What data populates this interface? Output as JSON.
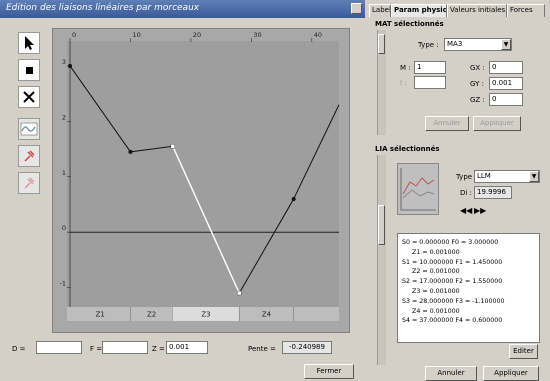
{
  "left_window": {
    "title": "Edition des liaisons linéaires par morceaux",
    "footer": {
      "d_label": "D =",
      "d_value": "",
      "f_label": "F =",
      "f_value": "",
      "z_label": "Z =",
      "z_value": "0.001",
      "pente_label": "Pente =",
      "pente_value": "-0.240989",
      "close_label": "Fermer"
    }
  },
  "tools": [
    "select-arrow",
    "square",
    "cross",
    "wave",
    "pin",
    "pin-alt"
  ],
  "chart_data": {
    "type": "line",
    "x_ticks": [
      "0",
      "10",
      "20",
      "30",
      "40"
    ],
    "x_tick_values": [
      0,
      10,
      20,
      30,
      40
    ],
    "y_ticks": [
      "3",
      "2",
      "1",
      "0",
      "-1"
    ],
    "y_tick_values": [
      3,
      2,
      1,
      0,
      -1
    ],
    "xlim": [
      -0.5,
      44.5
    ],
    "ylim": [
      -1.35,
      3.45
    ],
    "points": [
      {
        "x": 0,
        "y": 3.0,
        "marker": "dark"
      },
      {
        "x": 10,
        "y": 1.45,
        "marker": "dark"
      },
      {
        "x": 17,
        "y": 1.55,
        "marker": "light"
      },
      {
        "x": 28,
        "y": -1.1,
        "marker": "light"
      },
      {
        "x": 37,
        "y": 0.6,
        "marker": "dark"
      },
      {
        "x": 44.5,
        "y": 2.3,
        "marker": "none"
      }
    ],
    "highlight_segment": [
      2,
      3
    ],
    "baseline_y": 0,
    "zones": [
      {
        "label": "Z1",
        "from": 0,
        "to": 10
      },
      {
        "label": "Z2",
        "from": 10,
        "to": 17
      },
      {
        "label": "Z3",
        "from": 17,
        "to": 28
      },
      {
        "label": "Z4",
        "from": 28,
        "to": 37
      }
    ],
    "active_zone": 2,
    "colors": {
      "plot_bg": "#9e9e9e",
      "line": "#111111",
      "highlight": "#ffffff",
      "axis_band": "#bdbdbd",
      "active_zone": "#dcdcdc"
    }
  },
  "right_window": {
    "tabs": [
      "Labels",
      "Param physiques",
      "Valeurs initiales",
      "Forces"
    ],
    "active_tab": 1,
    "mat_section": {
      "title": "MAT sélectionnés",
      "type_label": "Type :",
      "type_value": "MA3",
      "m_label": "M :",
      "m_value": "1",
      "i_label": "I :",
      "i_value": "",
      "gx_label": "GX :",
      "gx_value": "0",
      "gy_label": "GY :",
      "gy_value": "0.001",
      "gz_label": "GZ :",
      "gz_value": "0",
      "btn_annuler": "Annuler",
      "btn_appliquer": "Appliquer"
    },
    "lia_section": {
      "title": "LIA sélectionnés",
      "type_label": "Type :",
      "type_value": "LLM",
      "di_label": "Di :",
      "di_value": "19.9996",
      "list": [
        {
          "text": "S0 = 0.000000 F0 = 3.000000",
          "indent": false
        },
        {
          "text": "Z1 = 0.001000",
          "indent": true
        },
        {
          "text": "S1 = 10.000000 F1 = 1.450000",
          "indent": false
        },
        {
          "text": "Z2 = 0.001000",
          "indent": true
        },
        {
          "text": "S2 = 17.000000 F2 = 1.550000",
          "indent": false
        },
        {
          "text": "Z3 = 0.001000",
          "indent": true
        },
        {
          "text": "S3 = 28.000000 F3 = -1.100000",
          "indent": false
        },
        {
          "text": "Z4 = 0.001000",
          "indent": true
        },
        {
          "text": "S4 = 37.000000 F4 = 0.600000",
          "indent": false
        }
      ],
      "edit_label": "Editer"
    },
    "bottom": {
      "annuler": "Annuler",
      "appliquer": "Appliquer"
    }
  }
}
